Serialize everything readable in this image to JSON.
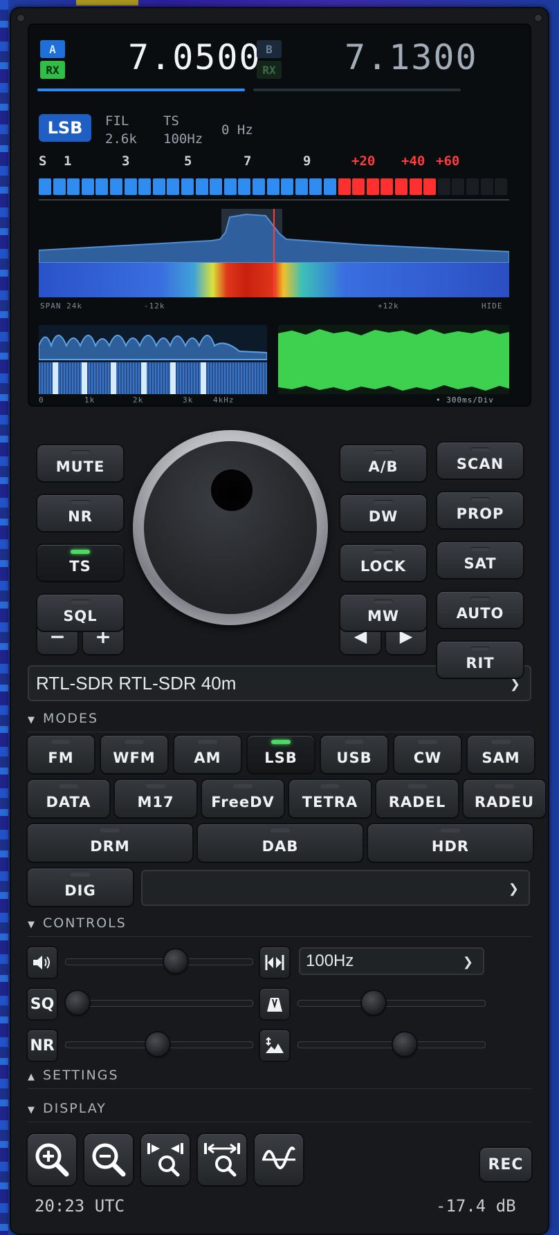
{
  "vfo_a": {
    "label": "A",
    "rx": "RX",
    "frequency": "7.0500"
  },
  "vfo_b": {
    "label": "B",
    "rx": "RX",
    "frequency": "7.1300"
  },
  "mode_badge": "LSB",
  "filter": {
    "label": "FIL",
    "value": "2.6k"
  },
  "tuning_step": {
    "label": "TS",
    "value": "100Hz"
  },
  "offset": "0 Hz",
  "smeter": {
    "labels": [
      "S",
      "1",
      "3",
      "5",
      "7",
      "9",
      "+20",
      "+40",
      "+60"
    ],
    "level_segments_blue": 21,
    "level_segments_red": 7,
    "total_segments": 33
  },
  "spectrum": {
    "span": "SPAN 24k",
    "left": "-12k",
    "right": "+12k",
    "hide": "HIDE"
  },
  "audio_scope": {
    "ticks": [
      "0",
      "1k",
      "2k",
      "3k",
      "4kHz"
    ],
    "timebase": "• 300ms/Div"
  },
  "left_buttons": [
    {
      "label": "MUTE",
      "on": false
    },
    {
      "label": "NR",
      "on": false
    },
    {
      "label": "TS",
      "on": true
    },
    {
      "label": "SQL",
      "on": false
    }
  ],
  "step_buttons": {
    "minus": "−",
    "plus": "+"
  },
  "right_col1": [
    {
      "label": "A/B"
    },
    {
      "label": "DW"
    },
    {
      "label": "LOCK"
    },
    {
      "label": "MW"
    }
  ],
  "right_col2": [
    {
      "label": "SCAN"
    },
    {
      "label": "PROP"
    },
    {
      "label": "SAT"
    },
    {
      "label": "AUTO"
    },
    {
      "label": "RIT"
    }
  ],
  "arrow_buttons": {
    "left": "◀",
    "right": "▶"
  },
  "device_select": "RTL-SDR RTL-SDR 40m",
  "sections": {
    "modes": "MODES",
    "controls": "CONTROLS",
    "settings": "SETTINGS",
    "display": "DISPLAY"
  },
  "modes_row1": [
    {
      "label": "FM",
      "on": false
    },
    {
      "label": "WFM",
      "on": false
    },
    {
      "label": "AM",
      "on": false
    },
    {
      "label": "LSB",
      "on": true
    },
    {
      "label": "USB",
      "on": false
    },
    {
      "label": "CW",
      "on": false
    },
    {
      "label": "SAM",
      "on": false
    }
  ],
  "modes_row2": [
    {
      "label": "DATA"
    },
    {
      "label": "M17"
    },
    {
      "label": "FreeDV"
    },
    {
      "label": "TETRA"
    },
    {
      "label": "RADEL"
    },
    {
      "label": "RADEU"
    }
  ],
  "modes_row3": [
    {
      "label": "DRM"
    },
    {
      "label": "DAB"
    },
    {
      "label": "HDR"
    }
  ],
  "dig_button": "DIG",
  "dig_select": "",
  "controls": {
    "filter_select": "100Hz",
    "sq_icon": "SQ",
    "nr_icon": "NR",
    "volume_level": 0.6,
    "squelch_level": 0.0,
    "nr_level": 0.49,
    "step_level": 0.39,
    "contrast_level": 0.58
  },
  "rec": "REC",
  "clock": "20:23 UTC",
  "level": "-17.4 dB",
  "colors": {
    "accent_blue": "#2f8cf0",
    "meter_red": "#ff3030",
    "led_green": "#4cd964",
    "audio_green": "#3ed04f"
  }
}
